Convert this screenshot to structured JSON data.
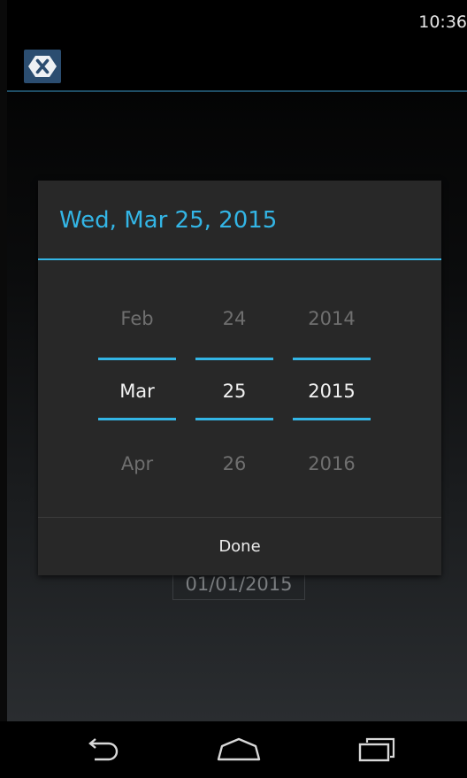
{
  "status_bar": {
    "time": "10:36"
  },
  "action_bar": {
    "app_icon": "xamarin-logo-icon"
  },
  "background_field": {
    "value": "01/01/2015"
  },
  "date_dialog": {
    "title": "Wed, Mar 25, 2015",
    "month_picker": {
      "prev": "Feb",
      "current": "Mar",
      "next": "Apr"
    },
    "day_picker": {
      "prev": "24",
      "current": "25",
      "next": "26"
    },
    "year_picker": {
      "prev": "2014",
      "current": "2015",
      "next": "2016"
    },
    "done_label": "Done"
  },
  "nav_bar": {
    "back_icon": "back-arrow-icon",
    "home_icon": "home-icon",
    "recents_icon": "recent-apps-icon"
  },
  "colors": {
    "accent": "#33b5e5",
    "dialog_background": "#282828",
    "app_icon_background": "#2b4d70"
  }
}
